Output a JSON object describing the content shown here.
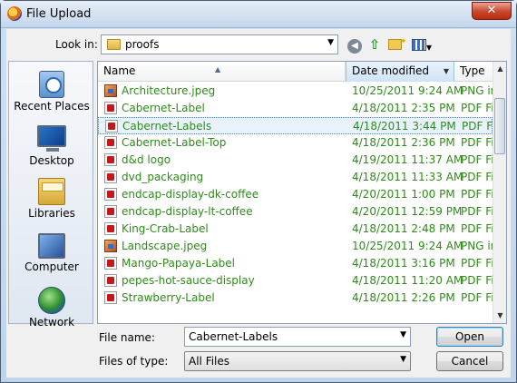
{
  "window": {
    "title": "File Upload",
    "close_glyph": "✕"
  },
  "lookin": {
    "label": "Look in:",
    "value": "proofs",
    "arrow": "▼"
  },
  "toolbar": {
    "back_glyph": "◀",
    "up_glyph": "⇧",
    "views_arrow": "▾"
  },
  "places": [
    {
      "label": "Recent Places",
      "icon": "recent-places-icon"
    },
    {
      "label": "Desktop",
      "icon": "desktop-icon"
    },
    {
      "label": "Libraries",
      "icon": "libraries-icon"
    },
    {
      "label": "Computer",
      "icon": "computer-icon"
    },
    {
      "label": "Network",
      "icon": "network-icon"
    }
  ],
  "columns": {
    "name": "Name",
    "date": "Date modified",
    "type": "Type",
    "sort_glyph": "▲",
    "dropdown_glyph": "▼"
  },
  "files": [
    {
      "name": "Architecture.jpeg",
      "date": "10/25/2011 9:24 AM",
      "type": "PNG im",
      "kind": "png"
    },
    {
      "name": "Cabernet-Label",
      "date": "4/18/2011 2:35 PM",
      "type": "PDF Fil",
      "kind": "pdf"
    },
    {
      "name": "Cabernet-Labels",
      "date": "4/18/2011 3:44 PM",
      "type": "PDF Fil",
      "kind": "pdf",
      "selected": true
    },
    {
      "name": "Cabernet-Label-Top",
      "date": "4/18/2011 2:36 PM",
      "type": "PDF Fil",
      "kind": "pdf"
    },
    {
      "name": "d&d logo",
      "date": "4/19/2011 11:37 AM",
      "type": "PDF Fil",
      "kind": "pdf"
    },
    {
      "name": "dvd_packaging",
      "date": "4/18/2011 11:33 AM",
      "type": "PDF Fil",
      "kind": "pdf"
    },
    {
      "name": "endcap-display-dk-coffee",
      "date": "4/20/2011 1:00 PM",
      "type": "PDF Fil",
      "kind": "pdf"
    },
    {
      "name": "endcap-display-lt-coffee",
      "date": "4/20/2011 12:59 PM",
      "type": "PDF Fil",
      "kind": "pdf"
    },
    {
      "name": "King-Crab-Label",
      "date": "4/18/2011 2:48 PM",
      "type": "PDF Fil",
      "kind": "pdf"
    },
    {
      "name": "Landscape.jpeg",
      "date": "10/25/2011 9:24 AM",
      "type": "PNG im",
      "kind": "png"
    },
    {
      "name": "Mango-Papaya-Label",
      "date": "4/18/2011 3:16 PM",
      "type": "PDF Fil",
      "kind": "pdf"
    },
    {
      "name": "pepes-hot-sauce-display",
      "date": "4/18/2011 11:20 AM",
      "type": "PDF Fil",
      "kind": "pdf"
    },
    {
      "name": "Strawberry-Label",
      "date": "4/18/2011 2:26 PM",
      "type": "PDF Fil",
      "kind": "pdf"
    }
  ],
  "scrollbar": {
    "up_glyph": "▲",
    "down_glyph": "▼"
  },
  "filename": {
    "label": "File name:",
    "value": "Cabernet-Labels",
    "arrow": "▼"
  },
  "filetype": {
    "label": "Files of type:",
    "value": "All Files",
    "arrow": "▼"
  },
  "buttons": {
    "open": "Open",
    "cancel": "Cancel"
  },
  "colors": {
    "file_text": "#2e8b1a",
    "selection_border": "#4e7fbf",
    "close_button": "#c9462c"
  }
}
